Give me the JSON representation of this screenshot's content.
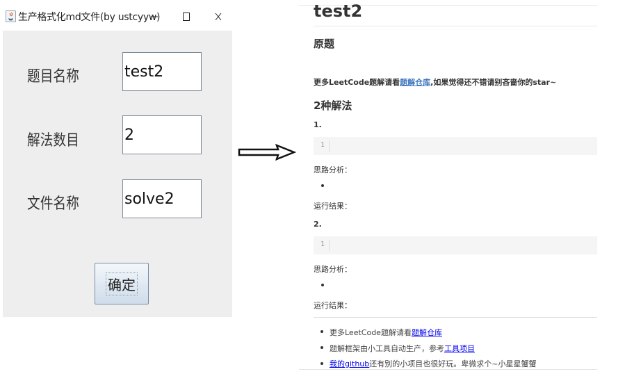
{
  "window": {
    "title": "生产格式化md文件(by ustcyyw)",
    "controls": {
      "minimize": "—",
      "maximize": "☐",
      "close": "╳"
    },
    "form": {
      "fields": [
        {
          "label": "题目名称",
          "value": "test2"
        },
        {
          "label": "解法数目",
          "value": "2"
        },
        {
          "label": "文件名称",
          "value": "solve2"
        }
      ],
      "confirm_label": "确定"
    }
  },
  "preview": {
    "title": "test2",
    "section_original": "原题",
    "intro_prefix": "更多LeetCode题解请看",
    "intro_link": "题解仓库",
    "intro_suffix": ",如果觉得还不错请别吝啬你的star~",
    "solutions_heading": "2种解法",
    "solutions": [
      {
        "number": "1.",
        "line_no": "1",
        "analysis_label": "思路分析：",
        "result_label": "运行结果："
      },
      {
        "number": "2.",
        "line_no": "1",
        "analysis_label": "思路分析：",
        "result_label": "运行结果："
      }
    ],
    "footer": [
      {
        "prefix": "更多LeetCode题解请看",
        "link": "题解仓库",
        "suffix": ""
      },
      {
        "prefix": "题解框架由小工具自动生产，参考",
        "link": "工具项目",
        "suffix": ""
      },
      {
        "prefix": "",
        "link": "我的github",
        "suffix": "还有别的小项目也很好玩。卑微求个~小星星蟹蟹"
      }
    ]
  }
}
